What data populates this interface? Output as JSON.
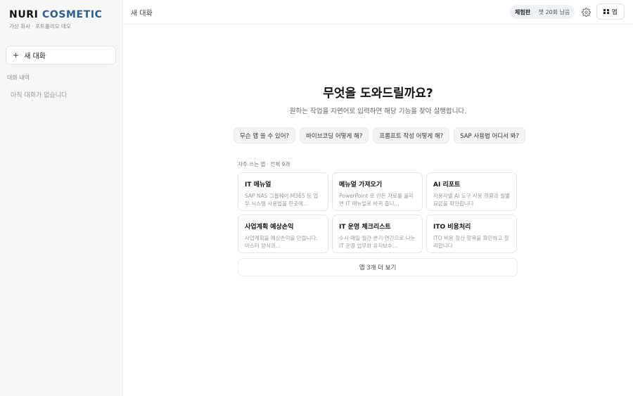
{
  "sidebar": {
    "brand_main": "NURI",
    "brand_accent": "COSMETIC",
    "brand_sub": "가상 회사 · 포트폴리오 데모",
    "new_chat_icon": "+",
    "new_chat_label": "새 대화",
    "history_label": "대화 내역",
    "history_empty": "아직 대화가 없습니다"
  },
  "header": {
    "title": "새 대화",
    "trial_label": "체험판",
    "trial_sep": "·",
    "trial_remaining": "챗 20회 남음",
    "settings_icon": "gear-icon",
    "apps_label": "앱",
    "apps_icon": "grid-icon"
  },
  "main": {
    "title": "무엇을 도와드릴까요?",
    "subtitle": "원하는 작업을 자연어로 입력하면 해당 기능을 찾아 실행합니다.",
    "suggestions": [
      "무슨 앱 쓸 수 있어?",
      "바이브코딩 어떻게 해?",
      "프롬프트 작성 어떻게 해?",
      "SAP 사용법 어디서 봐?"
    ],
    "section_label": "자주 쓰는 앱 · 전체 9개",
    "apps": [
      {
        "title": "IT 메뉴얼",
        "desc": "SAP NAS 그룹웨어 M365 등 업무 시스템 사용법을 한곳에..."
      },
      {
        "title": "메뉴얼 가져오기",
        "desc": "PowerPoint 로 만든 자료를 올리면 IT 메뉴얼로 바뀌 줍니..."
      },
      {
        "title": "AI 리포트",
        "desc": "사용자별 AI 도구 사용 현황과 월별 요금을 확인합니다"
      },
      {
        "title": "사업계획 예상손익",
        "desc": "사업계획을 예상손익을 만듭니다. 마스터 양식과..."
      },
      {
        "title": "IT 운영 체크리스트",
        "desc": "수시·매일·월간·분기·연간으로 나눈 IT 운영 업무와 유지보수..."
      },
      {
        "title": "ITO 비용처리",
        "desc": "ITO 비용 정산 항목을 확인하고 정리합니다"
      }
    ],
    "more_label": "앱 3개 더 보기"
  },
  "colors": {
    "brand_accent": "#2d5d8f",
    "sidebar_bg": "#f7f7f7",
    "trial_pill_bg": "#eef1f6"
  }
}
